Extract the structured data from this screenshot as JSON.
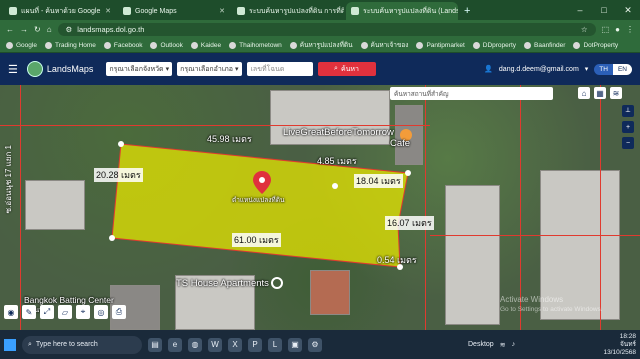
{
  "browser": {
    "tabs": [
      {
        "label": "แผนที่ - ค้นหาด้วย Google",
        "active": false
      },
      {
        "label": "Google Maps",
        "active": false
      },
      {
        "label": "ระบบค้นหารูปแปลงที่ดิน การที่ดิน - ค้น",
        "active": false
      },
      {
        "label": "ระบบค้นหารูปแปลงที่ดิน (LandsMap)",
        "active": true
      }
    ],
    "new_tab": "+",
    "url": "landsmaps.dol.go.th",
    "bookmarks": [
      "Google",
      "Trading Home",
      "Facebook",
      "Outlook",
      "Kaidee",
      "Thaihometown",
      "ค้นหารูปแปลงที่ดิน",
      "ค้นหาเจ้าของ",
      "Pantipmarket",
      "DDproperty",
      "Baanfinder",
      "DotProperty"
    ]
  },
  "app": {
    "name": "LandsMaps",
    "province_select": "กรุณาเลือกจังหวัด",
    "district_select": "กรุณาเลือกอำเภอ",
    "parcel_placeholder": "เลขที่โฉนด",
    "search_button": "ค้นหา",
    "user_email": "dang.d.deem@gmail.com",
    "lang_th": "TH",
    "lang_en": "EN"
  },
  "map": {
    "search_placeholder": "ค้นหาสถานที่สำคัญ",
    "place_labels": [
      "LiveGreatBeforeTomorrow",
      "Cafe",
      "TS House Apartments",
      "Bangkok Batting Center",
      "อ่อนนุช"
    ],
    "street_label": "ซ.อ่อนนุช 17 แยก 1",
    "marker_label": "ตำแหน่งแปลงที่ดิน",
    "dimensions": [
      "45.98 เมตร",
      "4.85 เมตร",
      "20.28 เมตร",
      "18.04 เมตร",
      "16.07 เมตร",
      "61.00 เมตร",
      "0.54 เมตร"
    ],
    "watermark": [
      "Activate Windows",
      "Go to Settings to activate Windows."
    ]
  },
  "taskbar": {
    "search_placeholder": "Type here to search",
    "desktop_label": "Desktop",
    "time": "18:28",
    "day": "จันทร์",
    "date": "13/10/2568"
  },
  "colors": {
    "parcel_fill": "#e6e600",
    "parcel_line": "#e03a2f",
    "app_header": "#0f2a5a",
    "search_button": "#e0313d"
  }
}
